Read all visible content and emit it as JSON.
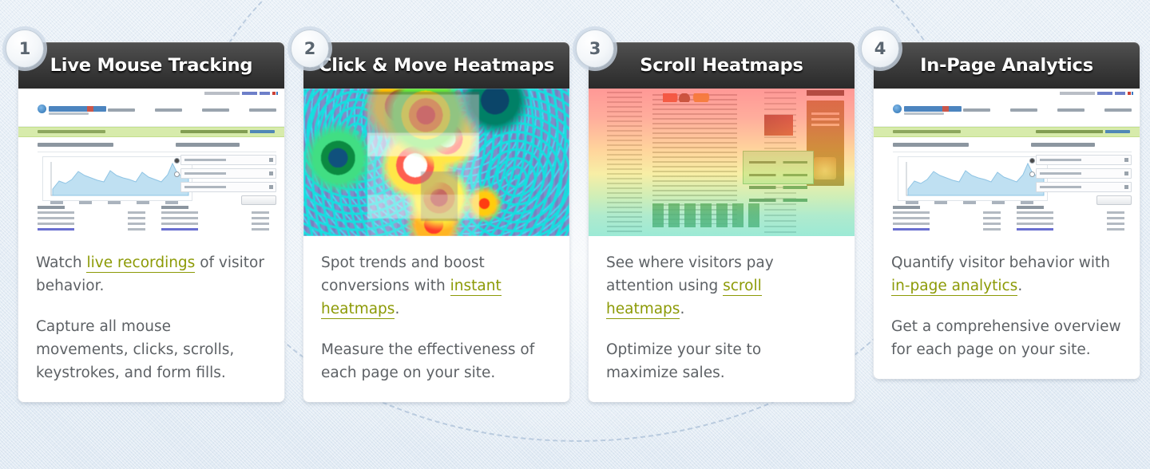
{
  "page": {
    "background_color": "#e3ecf5",
    "accent_link_color": "#8c9a06",
    "body_text_color": "#5d6165",
    "header_gradient_top": "#515151",
    "header_gradient_bottom": "#2a2a2a"
  },
  "cards": [
    {
      "number": "1",
      "title": "Live Mouse Tracking",
      "thumbnail": "mouseflow-dashboard-screenshot",
      "paragraphs": [
        {
          "parts": [
            {
              "text": "Watch ",
              "link": false
            },
            {
              "text": "live recordings",
              "link": true
            },
            {
              "text": " of visitor behavior.",
              "link": false
            }
          ]
        },
        {
          "parts": [
            {
              "text": "Capture all mouse movements, clicks, scrolls, keystrokes, and form fills.",
              "link": false
            }
          ]
        }
      ]
    },
    {
      "number": "2",
      "title": "Click & Move Heatmaps",
      "thumbnail": "click-heatmap-screenshot",
      "paragraphs": [
        {
          "parts": [
            {
              "text": "Spot trends and boost conversions with ",
              "link": false
            },
            {
              "text": "instant heatmaps",
              "link": true
            },
            {
              "text": ".",
              "link": false
            }
          ]
        },
        {
          "parts": [
            {
              "text": "Measure the effectiveness of each page on your site.",
              "link": false
            }
          ]
        }
      ]
    },
    {
      "number": "3",
      "title": "Scroll Heatmaps",
      "thumbnail": "scroll-heatmap-screenshot",
      "paragraphs": [
        {
          "parts": [
            {
              "text": "See where visitors pay attention using ",
              "link": false
            },
            {
              "text": "scroll heatmaps",
              "link": true
            },
            {
              "text": ".",
              "link": false
            }
          ]
        },
        {
          "parts": [
            {
              "text": "Optimize your site to maximize sales.",
              "link": false
            }
          ]
        }
      ]
    },
    {
      "number": "4",
      "title": "In-Page Analytics",
      "thumbnail": "mouseflow-dashboard-screenshot",
      "paragraphs": [
        {
          "parts": [
            {
              "text": "Quantify visitor behavior with ",
              "link": false
            },
            {
              "text": "in-page analytics",
              "link": true
            },
            {
              "text": ".",
              "link": false
            }
          ]
        },
        {
          "parts": [
            {
              "text": "Get a comprehensive overview for each page on your site.",
              "link": false
            }
          ]
        }
      ]
    }
  ]
}
